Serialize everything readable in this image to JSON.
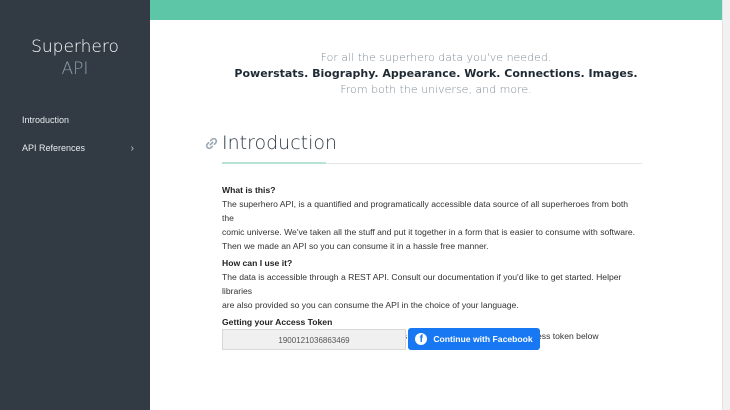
{
  "sidebar": {
    "brand_line1": "Superhero",
    "brand_line2": "API",
    "items": [
      {
        "label": "Introduction"
      },
      {
        "label": "API References",
        "chevron": "›"
      }
    ]
  },
  "hero": {
    "line1": "For all the superhero data you've needed.",
    "line2": "Powerstats. Biography. Appearance. Work. Connections. Images.",
    "line3": "From both the universe, and more."
  },
  "intro": {
    "title": "Introduction",
    "sections": [
      {
        "question": "What is this?",
        "lines": [
          "The superhero API, is a quantified and programatically accessible data source of all superheroes from both the",
          "comic universe. We've taken all the stuff and put it together in a form that is easier to consume with software.",
          "Then we made an API so you can consume it in a hassle free manner."
        ]
      },
      {
        "question": "How can I use it?",
        "lines": [
          "The data is accessible through a REST API. Consult our documentation if you'd like to get started. Helper libraries",
          "are also provided so you can consume the API in the choice of your language."
        ]
      },
      {
        "question": "Getting your Access Token",
        "lines": [
          "You need a facebook account to get your access token. You can generate your access token below"
        ]
      }
    ],
    "token_value": "1900121036863469",
    "facebook_button_label": "Continue with Facebook"
  },
  "colors": {
    "sidebar": "#323b44",
    "topbar": "#5cc6a6",
    "facebook": "#1877f2"
  },
  "icons": [
    "link-icon",
    "chevron-right-icon",
    "facebook-icon"
  ]
}
